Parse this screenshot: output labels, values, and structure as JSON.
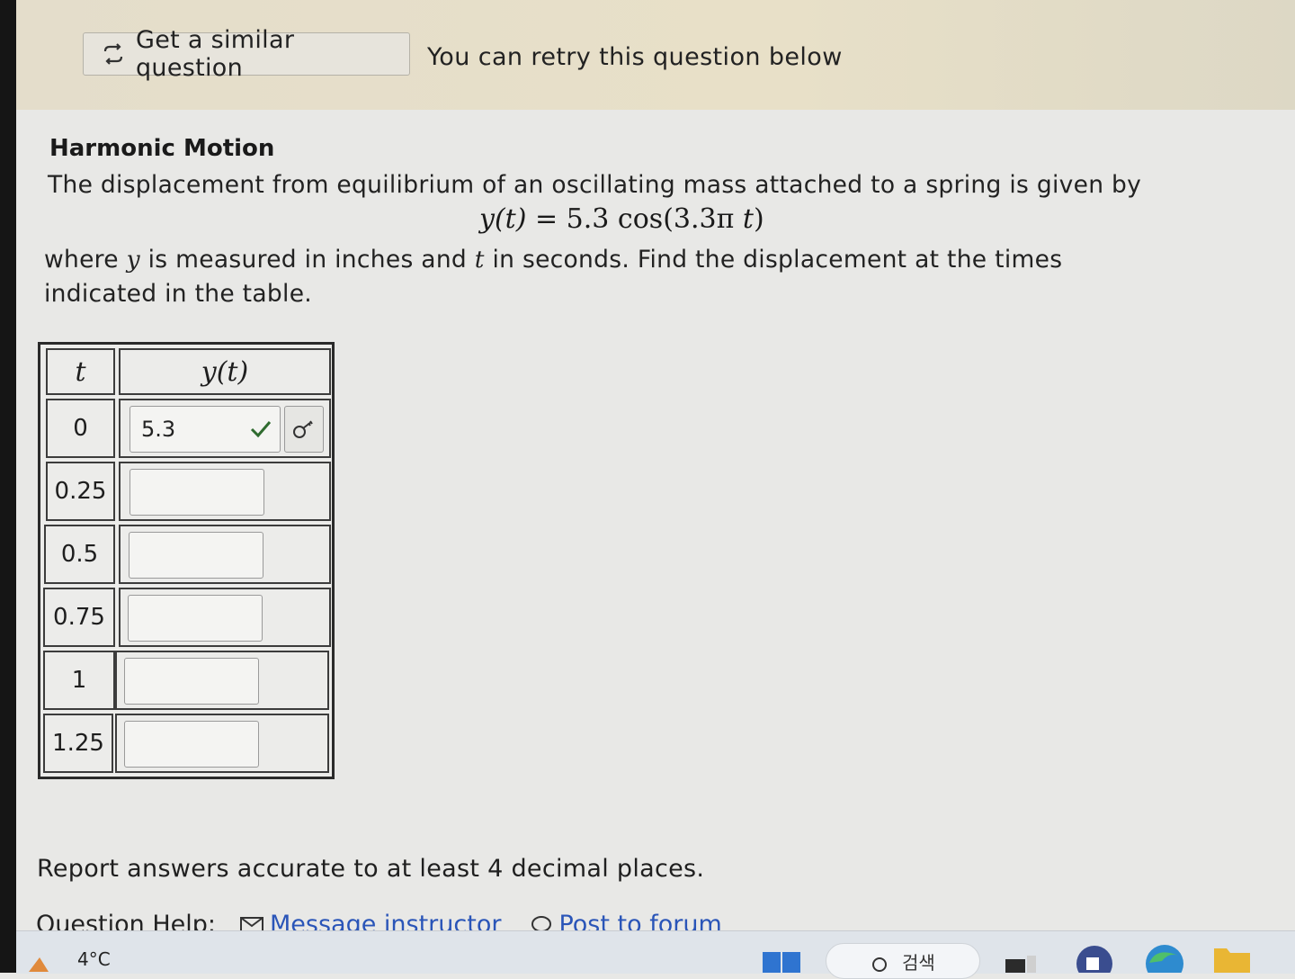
{
  "banner": {
    "similar_button_label": "Get a similar question",
    "retry_note": "You can retry this question below"
  },
  "question": {
    "title": "Harmonic Motion",
    "intro": "The displacement from equilibrium of an oscillating mass attached to a spring is given by",
    "formula": {
      "lhs": "y(t)",
      "rhs_coef": "5.3",
      "func": "cos",
      "arg_coef": "3.3π",
      "var": "t"
    },
    "where_prefix": "where",
    "var_y": "y",
    "where_mid": "is measured in inches and",
    "var_t": "t",
    "where_suffix": "in seconds. Find the displacement at the times indicated in the table."
  },
  "table": {
    "header_t": "t",
    "header_y": "y(t)",
    "rows": [
      {
        "t": "0",
        "answer": "5.3",
        "status": "correct"
      },
      {
        "t": "0.25",
        "answer": ""
      },
      {
        "t": "0.5",
        "answer": ""
      },
      {
        "t": "0.75",
        "answer": ""
      },
      {
        "t": "1",
        "answer": ""
      },
      {
        "t": "1.25",
        "answer": ""
      }
    ]
  },
  "footer": {
    "report_note": "Report answers accurate to at least 4 decimal places.",
    "help_label": "Question Help:",
    "message_link": "Message instructor",
    "forum_link": "Post to forum"
  },
  "taskbar": {
    "temperature": "4°C",
    "search_label": "검색"
  },
  "icons": [
    "refresh-icon",
    "check-icon",
    "key-icon",
    "mail-icon",
    "chat-icon",
    "weather-icon",
    "windows-icon",
    "search-icon",
    "taskview-icon",
    "app-icon",
    "edge-icon",
    "folder-icon"
  ],
  "colors": {
    "link": "#2a55b8",
    "check": "#2f6b2f",
    "banner": "#e6dfc9"
  }
}
